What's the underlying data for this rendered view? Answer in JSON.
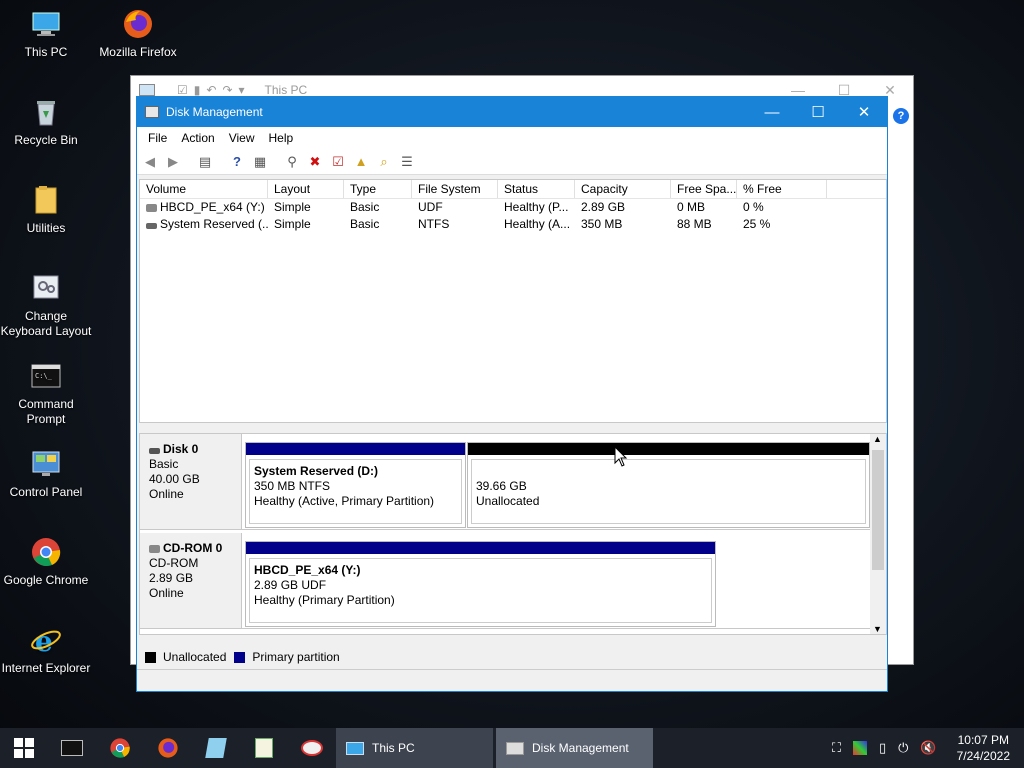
{
  "desktop": {
    "icons": [
      {
        "label": "This PC"
      },
      {
        "label": "Mozilla Firefox"
      },
      {
        "label": "Recycle Bin"
      },
      {
        "label": "Utilities"
      },
      {
        "label": "Change Keyboard Layout"
      },
      {
        "label": "Command Prompt"
      },
      {
        "label": "Control Panel"
      },
      {
        "label": "Google Chrome"
      },
      {
        "label": "Internet Explorer"
      }
    ]
  },
  "explorer": {
    "title": "This PC"
  },
  "disk_management": {
    "title": "Disk Management",
    "menu": [
      "File",
      "Action",
      "View",
      "Help"
    ],
    "columns": [
      "Volume",
      "Layout",
      "Type",
      "File System",
      "Status",
      "Capacity",
      "Free Spa...",
      "% Free"
    ],
    "volumes": [
      {
        "volume": "HBCD_PE_x64 (Y:)",
        "layout": "Simple",
        "type": "Basic",
        "fs": "UDF",
        "status": "Healthy (P...",
        "capacity": "2.89 GB",
        "free": "0 MB",
        "pct": "0 %"
      },
      {
        "volume": "System Reserved (...",
        "layout": "Simple",
        "type": "Basic",
        "fs": "NTFS",
        "status": "Healthy (A...",
        "capacity": "350 MB",
        "free": "88 MB",
        "pct": "25 %"
      }
    ],
    "disks": [
      {
        "name": "Disk 0",
        "kind": "Basic",
        "size": "40.00 GB",
        "state": "Online",
        "partitions": [
          {
            "name": "System Reserved  (D:)",
            "line2": "350 MB NTFS",
            "line3": "Healthy (Active, Primary Partition)"
          },
          {
            "name": "",
            "line2": "39.66 GB",
            "line3": "Unallocated"
          }
        ]
      },
      {
        "name": "CD-ROM 0",
        "kind": "CD-ROM",
        "size": "2.89 GB",
        "state": "Online",
        "partitions": [
          {
            "name": "HBCD_PE_x64  (Y:)",
            "line2": "2.89 GB UDF",
            "line3": "Healthy (Primary Partition)"
          }
        ]
      }
    ],
    "legend": {
      "unallocated": "Unallocated",
      "primary": "Primary partition"
    }
  },
  "taskbar": {
    "tasks": [
      {
        "label": "This PC"
      },
      {
        "label": "Disk Management"
      }
    ],
    "time": "10:07 PM",
    "date": "7/24/2022"
  },
  "colors": {
    "primary_partition": "#00008b",
    "unallocated": "#000000",
    "title_accent": "#1883d7"
  }
}
